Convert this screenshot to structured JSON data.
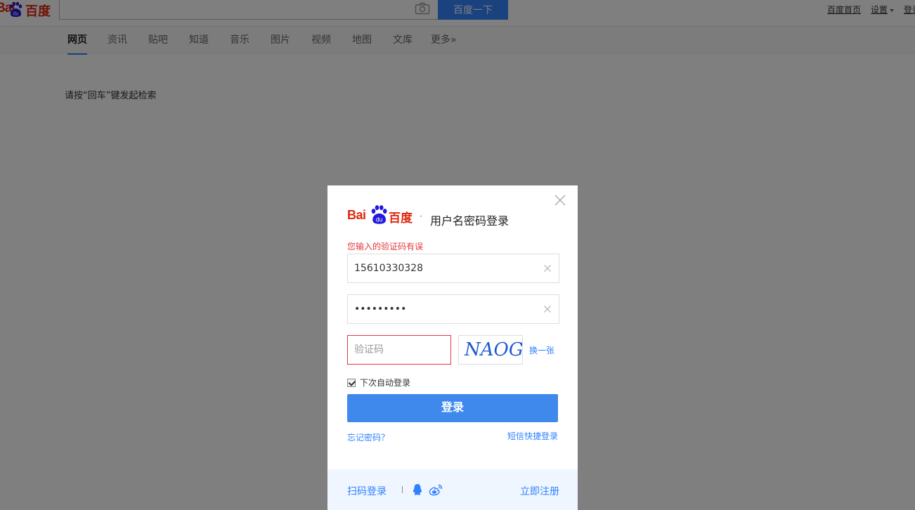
{
  "header": {
    "logo_latin": "Bai",
    "logo_du": "du",
    "logo_cn": "百度",
    "search_button": "百度一下",
    "links": [
      "百度首页",
      "设置",
      "登录"
    ]
  },
  "nav": {
    "tabs": [
      {
        "label": "网页",
        "active": true
      },
      {
        "label": "资讯"
      },
      {
        "label": "贴吧"
      },
      {
        "label": "知道"
      },
      {
        "label": "音乐"
      },
      {
        "label": "图片"
      },
      {
        "label": "视频"
      },
      {
        "label": "地图"
      },
      {
        "label": "文库"
      },
      {
        "label": "更多»"
      }
    ]
  },
  "main": {
    "hint": "请按“回车”键发起检索"
  },
  "dialog": {
    "logo_latin": "Bai",
    "logo_du": "du",
    "logo_cn": "百度",
    "title_sep": "·",
    "title": "用户名密码登录",
    "error": "您输入的验证码有误",
    "username_value": "15610330328",
    "password_value": "•••••••••",
    "captcha_placeholder": "验证码",
    "captcha_text": "NAOG",
    "refresh_label": "换一张",
    "remember_label": "下次自动登录",
    "remember_checked": true,
    "login_label": "登录",
    "forgot_label": "忘记密码？",
    "sms_label": "短信快捷登录",
    "footer": {
      "scan_label": "扫码登录",
      "register_label": "立即注册"
    }
  },
  "colors": {
    "brand_red": "#de2910",
    "brand_blue": "#3385ff",
    "link_blue": "#2e82ff",
    "error_red": "#e4393c",
    "login_button": "#3f89ec"
  },
  "icons": [
    "camera-icon",
    "close-icon",
    "clear-icon",
    "checkbox-icon",
    "qq-icon",
    "weibo-icon",
    "baidu-paw-icon"
  ]
}
